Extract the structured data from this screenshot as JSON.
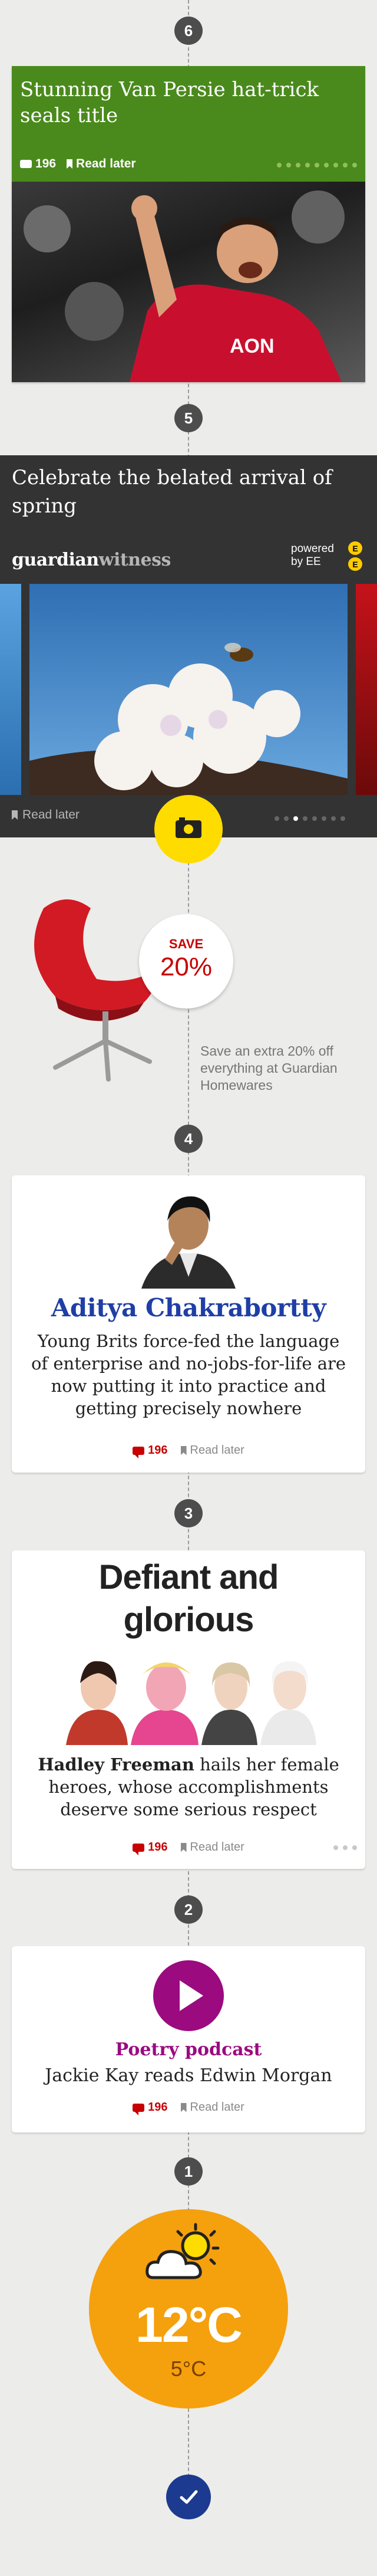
{
  "timeline": {
    "n6": "6",
    "n5": "5",
    "n4": "4",
    "n3": "3",
    "n2": "2",
    "n1": "1"
  },
  "story1": {
    "headline": "Stunning Van Persie hat-trick seals title",
    "comments": "196",
    "read_later": "Read later",
    "image_label": "Footballer celebrating in red kit"
  },
  "gallery": {
    "headline": "Celebrate the belated arrival of spring",
    "brand_guardian": "guardian",
    "brand_witness": "witness",
    "powered_by": "powered by EE",
    "ee_logo": "EE",
    "read_later": "Read later",
    "image_label": "Bee on white blossom"
  },
  "promo": {
    "save_label": "SAVE",
    "percent": "20%",
    "copy": "Save an extra 20% off everything at Guardian Homewares"
  },
  "card4": {
    "author": "Aditya Chakrabortty",
    "body": "Young Brits force-fed the language of enterprise and no-jobs-for-life are now putting it into practice and getting precisely nowhere",
    "comments": "196",
    "read_later": "Read later"
  },
  "card3": {
    "headline": "Defiant and glorious",
    "author": "Hadley Freeman",
    "body": " hails her female heroes, whose accomplishments deserve some serious respect",
    "comments": "196",
    "read_later": "Read later"
  },
  "card2": {
    "title": "Poetry podcast",
    "subtitle": "Jackie Kay reads Edwin Morgan",
    "comments": "196",
    "read_later": "Read later"
  },
  "weather": {
    "high": "12°C",
    "low": "5°C",
    "icon": "sun-cloud-icon"
  },
  "colors": {
    "green": "#4a8a1c",
    "dark": "#333333",
    "red": "#c70000",
    "blue": "#1f3fa6",
    "purple": "#9b0a7f",
    "orange": "#f5a00d",
    "navy": "#1c3a8f"
  }
}
